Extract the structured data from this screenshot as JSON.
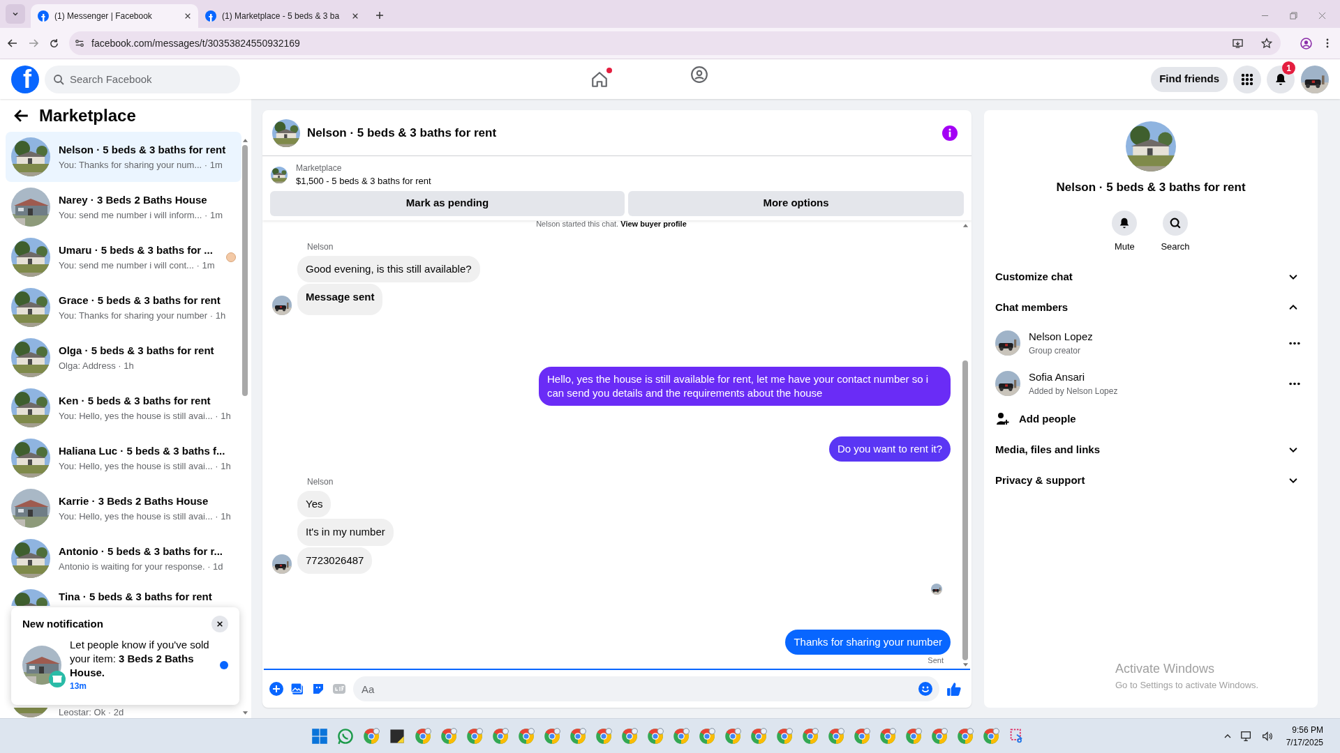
{
  "browser": {
    "tabs": [
      {
        "title": "(1) Messenger | Facebook",
        "selected": true
      },
      {
        "title": "(1) Marketplace - 5 beds & 3 ba",
        "selected": false
      }
    ],
    "url": "facebook.com/messages/t/30353824550932169"
  },
  "header": {
    "logo": "f",
    "search": {
      "placeholder": "Search Facebook"
    },
    "find_friends": "Find friends",
    "notification_count": "1",
    "home_dot": true
  },
  "sidebar": {
    "title": "Marketplace",
    "items": [
      {
        "title": "Nelson · 5 beds & 3 baths for rent",
        "preview": "You: Thanks for sharing your num... · 1m",
        "selected": true,
        "seen": false
      },
      {
        "title": "Narey · 3 Beds 2 Baths House",
        "preview": "You: send me number i will inform... · 1m",
        "selected": false,
        "seen": false
      },
      {
        "title": "Umaru · 5 beds & 3 baths for ...",
        "preview": "You: send me number i will cont... · 1m",
        "selected": false,
        "seen": true
      },
      {
        "title": "Grace · 5 beds & 3 baths for rent",
        "preview": "You: Thanks for sharing your number · 1h",
        "selected": false,
        "seen": false
      },
      {
        "title": "Olga · 5 beds & 3 baths for rent",
        "preview": "Olga: Address · 1h",
        "selected": false,
        "seen": false
      },
      {
        "title": "Ken · 5 beds & 3 baths for rent",
        "preview": "You: Hello, yes the house is still avai... · 1h",
        "selected": false,
        "seen": false
      },
      {
        "title": "Haliana Luc · 5 beds & 3 baths f...",
        "preview": "You: Hello, yes the house is still avai... · 1h",
        "selected": false,
        "seen": false
      },
      {
        "title": "Karrie · 3 Beds 2 Baths House",
        "preview": "You: Hello, yes the house is still avai... · 1h",
        "selected": false,
        "seen": false
      },
      {
        "title": "Antonio · 5 beds & 3 baths for r...",
        "preview": "Antonio is waiting for your response. · 1d",
        "selected": false,
        "seen": false
      },
      {
        "title": "Tina · 5 beds & 3 baths for rent",
        "selected": false,
        "seen": false
      },
      {
        "preview": "Leostar: Ok · 2d",
        "selected": false,
        "seen": false
      }
    ]
  },
  "notification": {
    "title": "New notification",
    "text": "Let people know if you've sold your item: **3 Beds 2 Baths House.**",
    "time": "13m",
    "unread": true
  },
  "chat": {
    "title": "Nelson · 5 beds & 3 baths for rent",
    "listing": {
      "label": "Marketplace",
      "text": "$1,500 - 5 beds & 3 baths for rent"
    },
    "buttons": [
      "Mark as pending",
      "More options"
    ],
    "intro": "Nelson started this chat.",
    "intro_link": "View buyer profile",
    "groups": [
      {
        "kind": "incoming",
        "sender": "Nelson",
        "messages": [
          {
            "text": "Good evening, is this still available?",
            "bold": false
          },
          {
            "text": "Message sent",
            "bold": true
          }
        ]
      },
      {
        "kind": "outgoing",
        "messages": [
          {
            "text": "Hello, yes the house is still available for rent, let me have your contact number so i can send you details and the requirements about the house",
            "color": "#6a2cf6"
          }
        ]
      },
      {
        "kind": "outgoing",
        "messages": [
          {
            "text": "Do you want to rent it?",
            "color": "#5a36f4"
          }
        ]
      },
      {
        "kind": "incoming",
        "sender": "Nelson",
        "messages": [
          {
            "text": "Yes",
            "bold": false
          },
          {
            "text": "It's in my number",
            "bold": false
          },
          {
            "text": "7723026487",
            "bold": false
          }
        ]
      },
      {
        "kind": "receipt"
      },
      {
        "kind": "outgoing",
        "messages": [
          {
            "text": "Thanks for sharing your number",
            "color": "#0866ff"
          }
        ]
      }
    ],
    "status": "Sent",
    "composer": {
      "placeholder": "Aa"
    }
  },
  "info": {
    "title": "Nelson · 5 beds & 3 baths for rent",
    "actions": [
      {
        "label": "Mute",
        "kind": "bell"
      },
      {
        "label": "Search",
        "kind": "search"
      }
    ],
    "sections": [
      {
        "label": "Customize chat",
        "expanded": false
      },
      {
        "label": "Chat members",
        "expanded": true,
        "members": [
          {
            "name": "Nelson Lopez",
            "role": "Group creator"
          },
          {
            "name": "Sofia Ansari",
            "role": "Added by Nelson Lopez"
          }
        ],
        "add": "Add people"
      },
      {
        "label": "Media, files and links",
        "expanded": false
      },
      {
        "label": "Privacy & support",
        "expanded": false
      }
    ]
  },
  "watermark": {
    "title": "Activate Windows",
    "text": "Go to Settings to activate Windows."
  },
  "taskbar": {
    "time": "9:56 PM",
    "date": "7/17/2025"
  }
}
